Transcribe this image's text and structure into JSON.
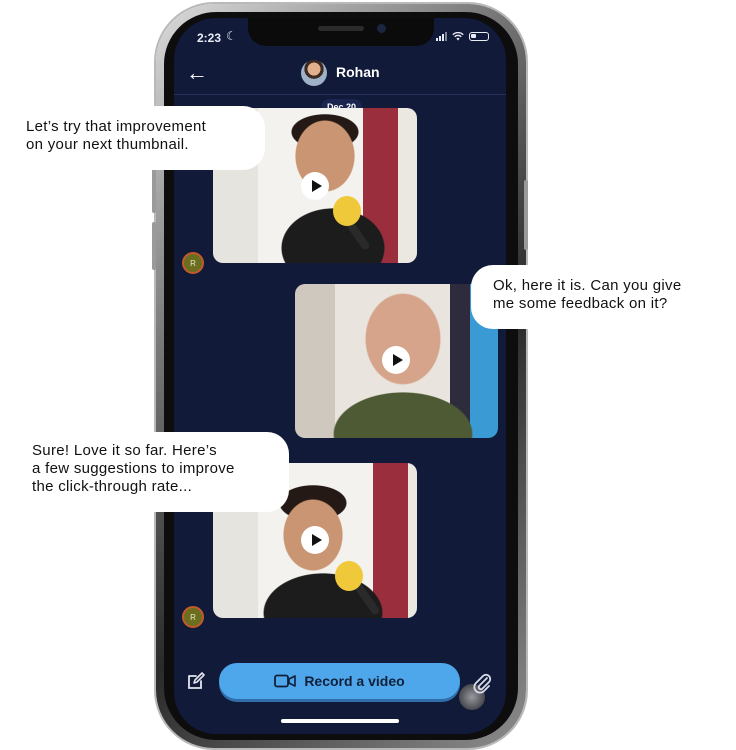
{
  "status_bar": {
    "time": "2:23"
  },
  "header": {
    "contact_name": "Rohan"
  },
  "thread": {
    "date_label": "Dec 20",
    "sender_initial": "R"
  },
  "bubbles": {
    "first": "Let’s try that improvement\non your next thumbnail.",
    "second": "Ok, here it is. Can you give\nme some feedback on it?",
    "third": "Sure! Love it so far. Here’s\na few suggestions to improve\nthe click-through rate..."
  },
  "composer": {
    "record_label": "Record a video"
  },
  "colors": {
    "screen_bg": "#121a3a",
    "record_button": "#4ea7ea",
    "bubble": "#ffffff"
  },
  "icons": [
    "moon-icon",
    "signal-icon",
    "wifi-icon",
    "battery-icon",
    "back-arrow-icon",
    "play-icon",
    "compose-icon",
    "video-camera-icon",
    "paperclip-icon"
  ]
}
